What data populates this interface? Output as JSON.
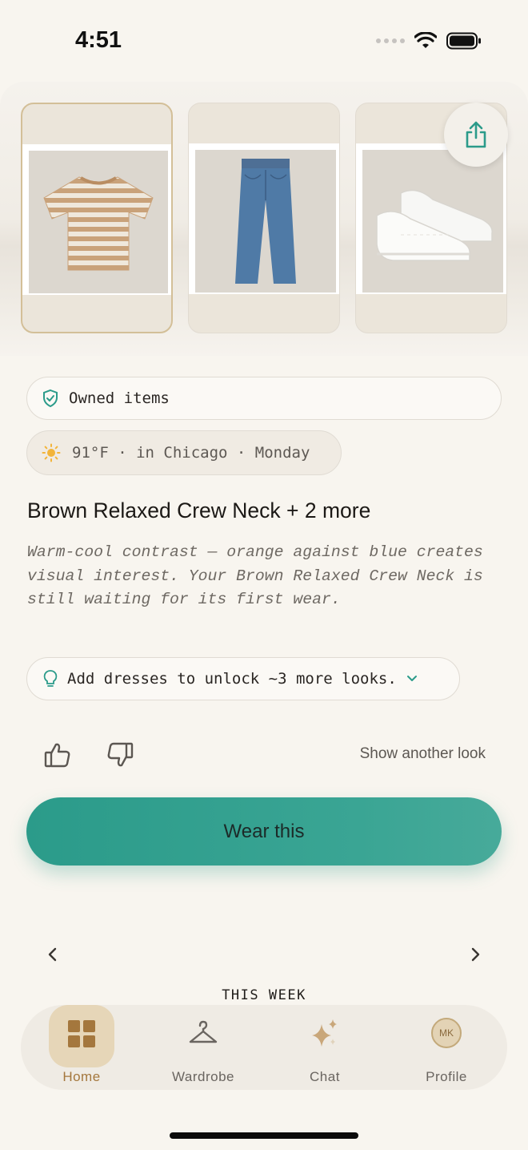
{
  "status_bar": {
    "time": "4:51"
  },
  "outfit": {
    "items": [
      {
        "name": "tshirt-photo",
        "selected": true
      },
      {
        "name": "jeans-photo",
        "selected": false
      },
      {
        "name": "sneakers-photo",
        "selected": false
      }
    ],
    "share_icon": "share-icon"
  },
  "badges": {
    "owned": {
      "icon": "shield-check-icon",
      "label": "Owned items"
    },
    "weather": {
      "icon": "sun-icon",
      "label": "91°F · in Chicago · Monday"
    }
  },
  "look": {
    "title": "Brown Relaxed Crew Neck + 2 more",
    "description": "Warm-cool contrast — orange against blue creates visual interest. Your Brown Relaxed Crew Neck is still waiting for its first wear."
  },
  "unlock": {
    "icon": "lightbulb-icon",
    "label": "Add dresses to unlock ~3 more looks.",
    "chevron": "chevron-down-icon"
  },
  "feedback": {
    "show_another_label": "Show another look"
  },
  "primary_action": {
    "label": "Wear this"
  },
  "week": {
    "label": "THIS WEEK"
  },
  "tabbar": {
    "tabs": [
      {
        "label": "Home",
        "icon": "grid-icon",
        "active": true
      },
      {
        "label": "Wardrobe",
        "icon": "hanger-icon",
        "active": false
      },
      {
        "label": "Chat",
        "icon": "sparkles-icon",
        "active": false
      },
      {
        "label": "Profile",
        "icon": "avatar",
        "active": false
      }
    ],
    "profile_initials": "MK"
  },
  "colors": {
    "accent": "#2b9b8a",
    "brand_gold": "#a4773d",
    "background": "#f8f5ef"
  }
}
